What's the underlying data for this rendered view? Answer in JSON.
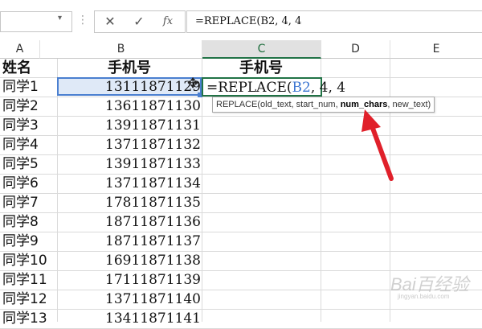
{
  "formula_bar": {
    "cancel_icon": "✕",
    "enter_icon": "✓",
    "fx_label": "fx",
    "formula": "=REPLACE(B2, 4, 4"
  },
  "columns": [
    "A",
    "B",
    "C",
    "D",
    "E"
  ],
  "header_row": {
    "col_a": "姓名",
    "col_b": "手机号",
    "col_c": "手机号"
  },
  "rows": [
    {
      "name": "同学1",
      "phone": "13111871129"
    },
    {
      "name": "同学2",
      "phone": "13611871130"
    },
    {
      "name": "同学3",
      "phone": "13911871131"
    },
    {
      "name": "同学4",
      "phone": "13711871132"
    },
    {
      "name": "同学5",
      "phone": "13911871133"
    },
    {
      "name": "同学6",
      "phone": "13711871134"
    },
    {
      "name": "同学7",
      "phone": "17811871135"
    },
    {
      "name": "同学8",
      "phone": "18711871136"
    },
    {
      "name": "同学9",
      "phone": "18711871137"
    },
    {
      "name": "同学10",
      "phone": "16911871138"
    },
    {
      "name": "同学11",
      "phone": "17111871139"
    },
    {
      "name": "同学12",
      "phone": "13711871140"
    },
    {
      "name": "同学13",
      "phone": "13411871141"
    }
  ],
  "active_cell": {
    "prefix": "=REPLACE(",
    "ref": "B2",
    "suffix": ", 4, 4"
  },
  "tooltip": {
    "before": "REPLACE(old_text, start_num, ",
    "bold": "num_chars",
    "after": ", new_text)"
  },
  "watermark": {
    "text": "Bai百经验",
    "sub": "jingyan.baidu.com"
  },
  "colors": {
    "accent_green": "#217346",
    "ref_blue": "#3b75d1",
    "arrow_red": "#e0202a"
  }
}
